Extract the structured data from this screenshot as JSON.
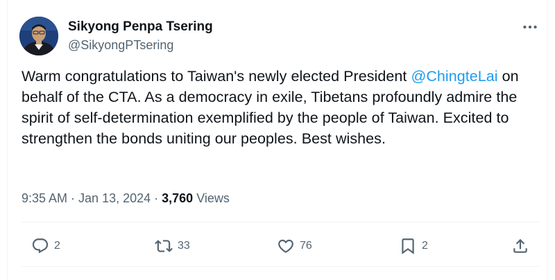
{
  "author": {
    "name": "Sikyong Penpa Tsering",
    "handle": "@SikyongPTsering"
  },
  "tweet": {
    "text_before": "Warm congratulations to Taiwan's newly elected President ",
    "mention": "@ChingteLai",
    "text_after": " on behalf of the CTA. As a democracy in exile, Tibetans profoundly admire the spirit of self-determination exemplified by the people of Taiwan. Excited to strengthen the bonds uniting our peoples. Best wishes."
  },
  "meta": {
    "time": "9:35 AM",
    "sep1": " · ",
    "date": "Jan 13, 2024",
    "sep2": " · ",
    "views_count": "3,760",
    "views_label": " Views"
  },
  "actions": {
    "replies": "2",
    "reposts": "33",
    "likes": "76",
    "bookmarks": "2"
  },
  "icons": [
    "more-icon",
    "reply-icon",
    "repost-icon",
    "like-icon",
    "bookmark-icon",
    "share-icon"
  ]
}
